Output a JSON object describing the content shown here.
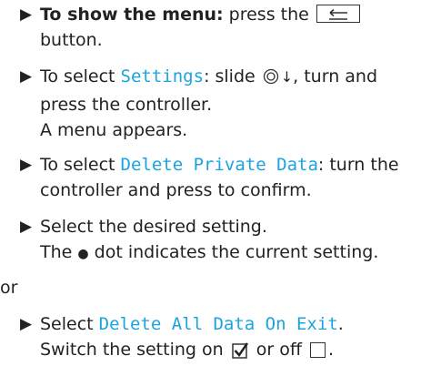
{
  "colors": {
    "accent": "#1ba3e0",
    "text": "#222222"
  },
  "step1": {
    "bold": "To show the menu:",
    "pre": " press the ",
    "post": "button."
  },
  "step2": {
    "pre": "To select ",
    "ui": "Settings",
    "mid": ": slide ",
    "arrow": "↓",
    "post1": ", turn and",
    "post2": "press the controller.",
    "result": "A menu appears."
  },
  "step3": {
    "pre": "To select ",
    "ui": "Delete Private Data",
    "post1": ": turn the",
    "post2": "controller and press to confirm."
  },
  "step4": {
    "line1": "Select the desired setting.",
    "pre": "The ",
    "dot": "●",
    "post": " dot indicates the current setting."
  },
  "or_label": "or",
  "step5": {
    "pre": "Select ",
    "ui": "Delete All Data On Exit",
    "post": ".",
    "line2_pre": "Switch the setting on ",
    "line2_mid": " or off ",
    "line2_post": "."
  },
  "icons": {
    "bullet": "play-triangle-icon",
    "back": "back-button-icon",
    "controller": "controller-icon",
    "checked": "checkbox-checked-icon",
    "unchecked": "checkbox-unchecked-icon"
  }
}
